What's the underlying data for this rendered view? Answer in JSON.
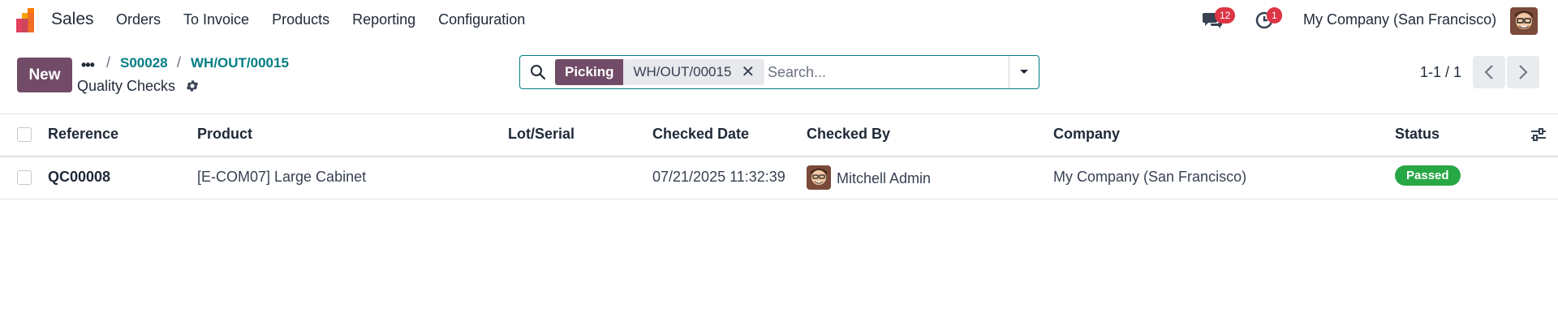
{
  "navbar": {
    "app_name": "Sales",
    "menu": [
      "Orders",
      "To Invoice",
      "Products",
      "Reporting",
      "Configuration"
    ],
    "chat_count": "12",
    "activity_count": "1",
    "company": "My Company (San Francisco)"
  },
  "control_panel": {
    "new_label": "New",
    "breadcrumb_dots": "•••",
    "breadcrumbs": [
      "S00028",
      "WH/OUT/00015"
    ],
    "title": "Quality Checks"
  },
  "search": {
    "facet_label": "Picking",
    "facet_value": "WH/OUT/00015",
    "placeholder": "Search..."
  },
  "pager": {
    "value": "1-1 / 1"
  },
  "table": {
    "columns": [
      "Reference",
      "Product",
      "Lot/Serial",
      "Checked Date",
      "Checked By",
      "Company",
      "Status"
    ],
    "rows": [
      {
        "reference": "QC00008",
        "product": "[E-COM07] Large Cabinet",
        "lot": "",
        "checked_date": "07/21/2025 11:32:39",
        "checked_by": "Mitchell Admin",
        "company": "My Company (San Francisco)",
        "status": "Passed"
      }
    ]
  },
  "colors": {
    "brand": "#714b67",
    "link": "#017e84",
    "success": "#28a745",
    "danger": "#dc3545"
  }
}
